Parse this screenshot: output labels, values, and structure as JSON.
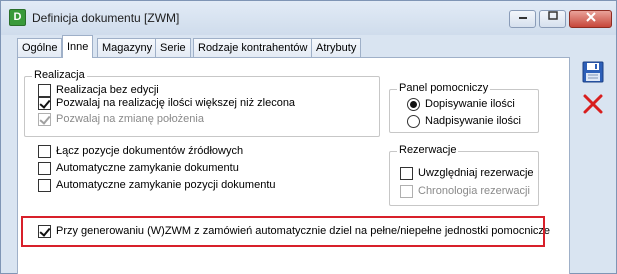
{
  "window": {
    "icon_letter": "D",
    "title": "Definicja dokumentu [ZWM]"
  },
  "tabs": [
    {
      "label": "Ogólne",
      "active": false
    },
    {
      "label": "Inne",
      "active": true
    },
    {
      "label": "Magazyny",
      "active": false
    },
    {
      "label": "Serie",
      "active": false
    },
    {
      "label": "Rodzaje kontrahentów",
      "active": false
    },
    {
      "label": "Atrybuty",
      "active": false
    }
  ],
  "realizacja": {
    "label": "Realizacja",
    "options": [
      {
        "label": "Realizacja bez edycji",
        "checked": false,
        "disabled": false
      },
      {
        "label": "Pozwalaj na realizację ilości większej niż zlecona",
        "checked": true,
        "disabled": false
      },
      {
        "label": "Pozwalaj na zmianę położenia",
        "checked": true,
        "disabled": true
      }
    ]
  },
  "panel_pomocniczy": {
    "label": "Panel pomocniczy",
    "options": [
      {
        "label": "Dopisywanie ilości",
        "selected": true
      },
      {
        "label": "Nadpisywanie ilości",
        "selected": false
      }
    ]
  },
  "misc_options": [
    {
      "label": "Łącz pozycje dokumentów źródłowych",
      "checked": false
    },
    {
      "label": "Automatyczne zamykanie dokumentu",
      "checked": false
    },
    {
      "label": "Automatyczne zamykanie pozycji dokumentu",
      "checked": false
    }
  ],
  "rezerwacje": {
    "label": "Rezerwacje",
    "options": [
      {
        "label": "Uwzględniaj rezerwacje",
        "checked": false,
        "disabled": false
      },
      {
        "label": "Chronologia rezerwacji",
        "checked": false,
        "disabled": true
      }
    ]
  },
  "highlighted_option": {
    "label": "Przy generowaniu (W)ZWM z zamówień automatycznie dziel na pełne/niepełne jednostki pomocnicze",
    "checked": true
  },
  "colors": {
    "highlight_border": "#d8202a",
    "save_icon": "#2d5fb8",
    "cancel_icon": "#d81e1e"
  }
}
